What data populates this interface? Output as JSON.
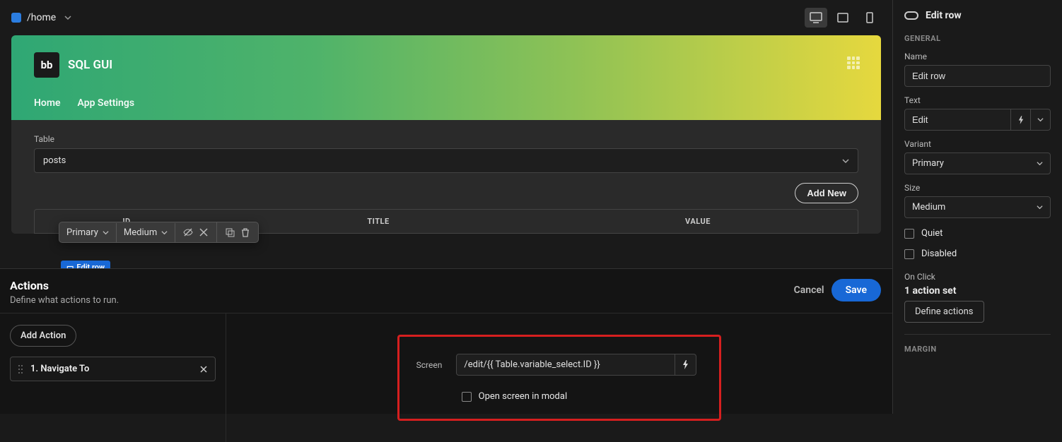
{
  "topbar": {
    "breadcrumb": "/home"
  },
  "app": {
    "logo_text": "bb",
    "title": "SQL GUI",
    "nav": [
      "Home",
      "App Settings"
    ]
  },
  "preview": {
    "table_label": "Table",
    "table_value": "posts",
    "add_new": "Add New",
    "columns": [
      "ID",
      "TITLE",
      "VALUE"
    ],
    "edit_chip": "Edit row"
  },
  "float_toolbar": {
    "variant": "Primary",
    "size": "Medium"
  },
  "actions": {
    "title": "Actions",
    "subtitle": "Define what actions to run.",
    "cancel": "Cancel",
    "save": "Save",
    "add_action": "Add Action",
    "steps": [
      "1. Navigate To"
    ],
    "screen_label": "Screen",
    "screen_value": "/edit/{{ Table.variable_select.ID }}",
    "open_modal": "Open screen in modal"
  },
  "right": {
    "component_name": "Edit row",
    "section_general": "GENERAL",
    "name_label": "Name",
    "name_value": "Edit row",
    "text_label": "Text",
    "text_value": "Edit",
    "variant_label": "Variant",
    "variant_value": "Primary",
    "size_label": "Size",
    "size_value": "Medium",
    "quiet": "Quiet",
    "disabled": "Disabled",
    "onclick_label": "On Click",
    "onclick_value": "1 action set",
    "define_actions": "Define actions",
    "section_margin": "MARGIN"
  }
}
